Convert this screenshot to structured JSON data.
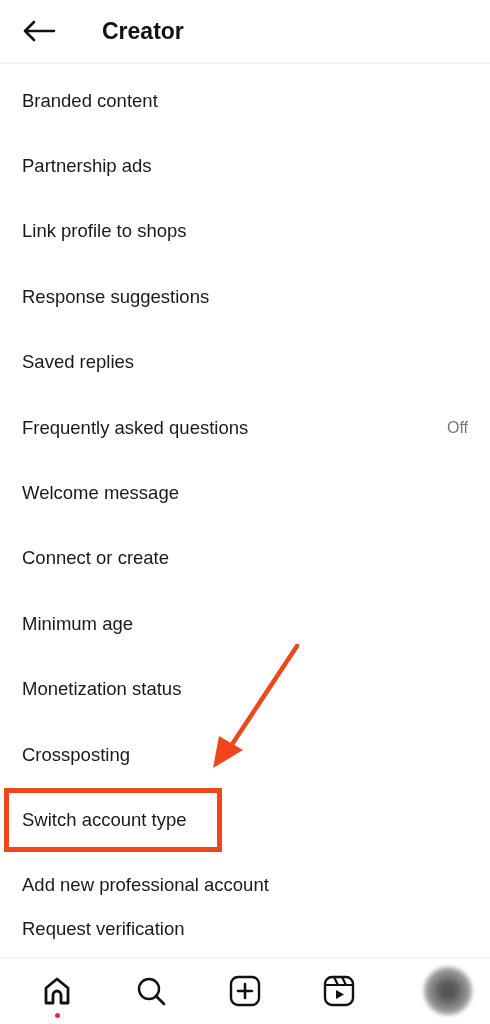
{
  "header": {
    "title": "Creator"
  },
  "items": [
    {
      "label": "Branded content",
      "highlighted": false
    },
    {
      "label": "Partnership ads",
      "highlighted": false
    },
    {
      "label": "Link profile to shops",
      "highlighted": false
    },
    {
      "label": "Response suggestions",
      "highlighted": false
    },
    {
      "label": "Saved replies",
      "highlighted": false
    },
    {
      "label": "Frequently asked questions",
      "value": "Off",
      "highlighted": false
    },
    {
      "label": "Welcome message",
      "highlighted": false
    },
    {
      "label": "Connect or create",
      "highlighted": false
    },
    {
      "label": "Minimum age",
      "highlighted": false
    },
    {
      "label": "Monetization status",
      "highlighted": false
    },
    {
      "label": "Crossposting",
      "highlighted": false
    },
    {
      "label": "Switch account type",
      "highlighted": true
    },
    {
      "label": "Add new professional account",
      "highlighted": false
    },
    {
      "label": "Request verification",
      "highlighted": false
    }
  ],
  "nav": [
    {
      "kind": "home",
      "selected": true
    },
    {
      "kind": "search",
      "selected": false
    },
    {
      "kind": "create",
      "selected": false
    },
    {
      "kind": "reels",
      "selected": false
    },
    {
      "kind": "profile",
      "selected": false
    }
  ]
}
